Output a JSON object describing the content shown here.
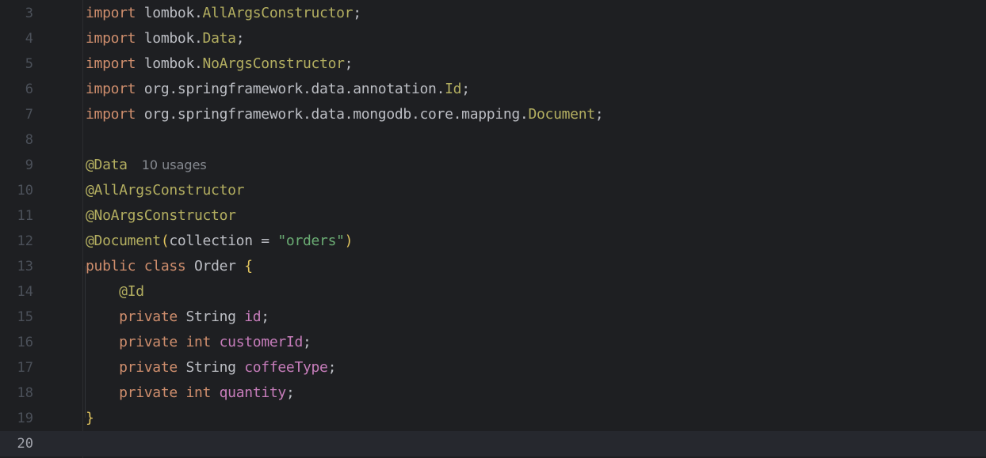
{
  "editor": {
    "lines": [
      {
        "num": "3",
        "tokens": [
          {
            "t": "import",
            "c": "kw"
          },
          {
            "t": " lombok.",
            "c": "plain"
          },
          {
            "t": "AllArgsConstructor",
            "c": "cls"
          },
          {
            "t": ";",
            "c": "plain"
          }
        ]
      },
      {
        "num": "4",
        "tokens": [
          {
            "t": "import",
            "c": "kw"
          },
          {
            "t": " lombok.",
            "c": "plain"
          },
          {
            "t": "Data",
            "c": "cls"
          },
          {
            "t": ";",
            "c": "plain"
          }
        ]
      },
      {
        "num": "5",
        "tokens": [
          {
            "t": "import",
            "c": "kw"
          },
          {
            "t": " lombok.",
            "c": "plain"
          },
          {
            "t": "NoArgsConstructor",
            "c": "cls"
          },
          {
            "t": ";",
            "c": "plain"
          }
        ]
      },
      {
        "num": "6",
        "tokens": [
          {
            "t": "import",
            "c": "kw"
          },
          {
            "t": " org.springframework.data.annotation.",
            "c": "plain"
          },
          {
            "t": "Id",
            "c": "cls"
          },
          {
            "t": ";",
            "c": "plain"
          }
        ]
      },
      {
        "num": "7",
        "tokens": [
          {
            "t": "import",
            "c": "kw"
          },
          {
            "t": " org.springframework.data.mongodb.core.mapping.",
            "c": "plain"
          },
          {
            "t": "Document",
            "c": "cls"
          },
          {
            "t": ";",
            "c": "plain"
          }
        ]
      },
      {
        "num": "8",
        "tokens": []
      },
      {
        "num": "9",
        "tokens": [
          {
            "t": "@Data",
            "c": "ann"
          }
        ],
        "hint": "10 usages"
      },
      {
        "num": "10",
        "tokens": [
          {
            "t": "@AllArgsConstructor",
            "c": "ann"
          }
        ]
      },
      {
        "num": "11",
        "tokens": [
          {
            "t": "@NoArgsConstructor",
            "c": "ann"
          }
        ]
      },
      {
        "num": "12",
        "tokens": [
          {
            "t": "@Document",
            "c": "ann"
          },
          {
            "t": "(",
            "c": "paren"
          },
          {
            "t": "collection = ",
            "c": "plain"
          },
          {
            "t": "\"orders\"",
            "c": "str"
          },
          {
            "t": ")",
            "c": "paren"
          }
        ]
      },
      {
        "num": "13",
        "tokens": [
          {
            "t": "public",
            "c": "kw"
          },
          {
            "t": " ",
            "c": "plain"
          },
          {
            "t": "class",
            "c": "kw"
          },
          {
            "t": " Order ",
            "c": "plain"
          },
          {
            "t": "{",
            "c": "brace"
          }
        ]
      },
      {
        "num": "14",
        "tokens": [
          {
            "t": "    ",
            "c": "plain"
          },
          {
            "t": "@Id",
            "c": "ann"
          }
        ]
      },
      {
        "num": "15",
        "tokens": [
          {
            "t": "    ",
            "c": "plain"
          },
          {
            "t": "private",
            "c": "kw"
          },
          {
            "t": " String ",
            "c": "plain"
          },
          {
            "t": "id",
            "c": "fld"
          },
          {
            "t": ";",
            "c": "plain"
          }
        ]
      },
      {
        "num": "16",
        "tokens": [
          {
            "t": "    ",
            "c": "plain"
          },
          {
            "t": "private",
            "c": "kw"
          },
          {
            "t": " ",
            "c": "plain"
          },
          {
            "t": "int",
            "c": "kw"
          },
          {
            "t": " ",
            "c": "plain"
          },
          {
            "t": "customerId",
            "c": "fld"
          },
          {
            "t": ";",
            "c": "plain"
          }
        ]
      },
      {
        "num": "17",
        "tokens": [
          {
            "t": "    ",
            "c": "plain"
          },
          {
            "t": "private",
            "c": "kw"
          },
          {
            "t": " String ",
            "c": "plain"
          },
          {
            "t": "coffeeType",
            "c": "fld"
          },
          {
            "t": ";",
            "c": "plain"
          }
        ]
      },
      {
        "num": "18",
        "tokens": [
          {
            "t": "    ",
            "c": "plain"
          },
          {
            "t": "private",
            "c": "kw"
          },
          {
            "t": " ",
            "c": "plain"
          },
          {
            "t": "int",
            "c": "kw"
          },
          {
            "t": " ",
            "c": "plain"
          },
          {
            "t": "quantity",
            "c": "fld"
          },
          {
            "t": ";",
            "c": "plain"
          }
        ]
      },
      {
        "num": "19",
        "tokens": [
          {
            "t": "}",
            "c": "brace"
          }
        ]
      },
      {
        "num": "20",
        "tokens": [],
        "current": true
      }
    ]
  },
  "colors": {
    "background": "#1e1f22",
    "keyword": "#cf8e6d",
    "annotation": "#b3ae60",
    "string": "#6aab73",
    "field": "#c77dbb",
    "brace": "#e0c35e",
    "line_number": "#4b5059"
  }
}
